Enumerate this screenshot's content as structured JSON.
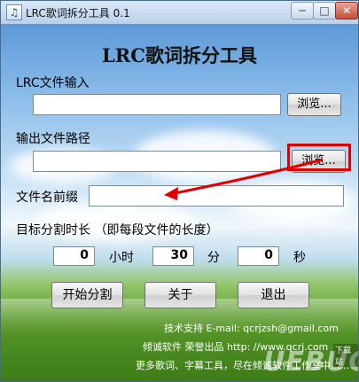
{
  "window": {
    "title": "LRC歌词拆分工具 0.1",
    "icon": "music-note-icon",
    "min_glyph": "─",
    "max_glyph": "□",
    "close_glyph": "✕"
  },
  "app_title": "LRC歌词拆分工具",
  "input": {
    "label": "LRC文件输入",
    "value": "",
    "browse_label": "浏览..."
  },
  "output": {
    "label": "输出文件路径",
    "value": "",
    "browse_label": "浏览..."
  },
  "prefix": {
    "label": "文件名前缀",
    "value": ""
  },
  "duration": {
    "label": "目标分割时长 （即每段文件的长度）",
    "hours": "0",
    "hours_unit": "小时",
    "minutes": "30",
    "minutes_unit": "分",
    "seconds": "0",
    "seconds_unit": "秒"
  },
  "buttons": {
    "start": "开始分割",
    "about": "关于",
    "exit": "退出"
  },
  "footer": {
    "support_line": "技术支持 E-mail: qcrjzsh@gmail.com",
    "company_line": "倾诚软件 荣誉出品  http: //www.qcrj.com",
    "more_line": "更多歌词、字幕工具，尽在倾诚软件工作室中......"
  },
  "watermark": {
    "brand": "UEBUG",
    "tag": "下载站"
  },
  "annotation": {
    "highlight_color": "#e00000",
    "arrow_color": "#e00000"
  }
}
